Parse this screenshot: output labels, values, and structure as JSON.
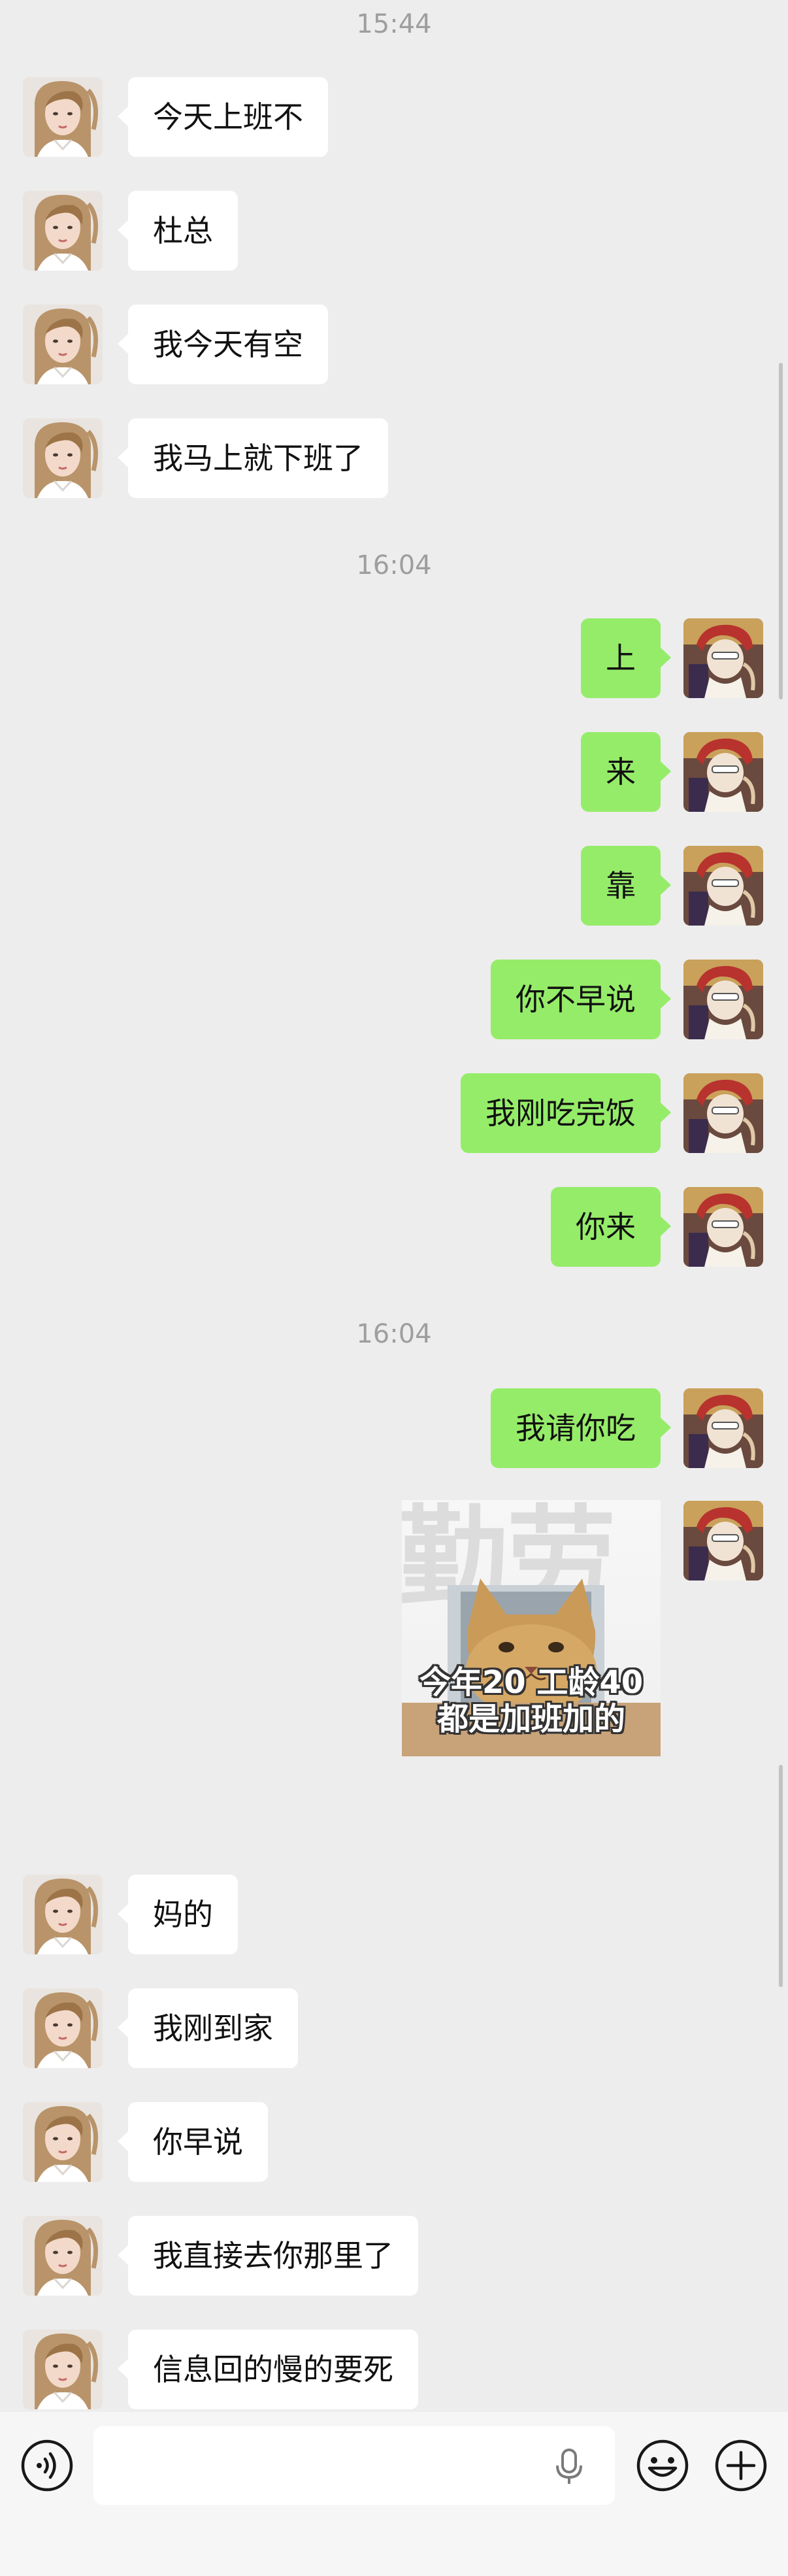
{
  "timestamps": [
    "15:44",
    "16:04",
    "16:04"
  ],
  "messages": {
    "m1": "今天上班不",
    "m2": "杜总",
    "m3": "我今天有空",
    "m4": "我马上就下班了",
    "m5": "上",
    "m6": "来",
    "m7": "靠",
    "m8": "你不早说",
    "m9": "我刚吃完饭",
    "m10": "你来",
    "m11": "我请你吃",
    "m12": "妈的",
    "m13": "我刚到家",
    "m14": "你早说",
    "m15": "我直接去你那里了",
    "m16": "信息回的慢的要死"
  },
  "sticker": {
    "bg_text": "勤劳",
    "line1": "今年20 工龄40",
    "line2": "都是加班加的"
  },
  "input": {
    "voice_icon": "voice-icon",
    "mic_icon": "microphone-icon",
    "emoji_icon": "emoji-icon",
    "plus_icon": "plus-icon"
  },
  "colors": {
    "background": "#ededed",
    "sent_bubble": "#95ec69",
    "received_bubble": "#ffffff"
  }
}
